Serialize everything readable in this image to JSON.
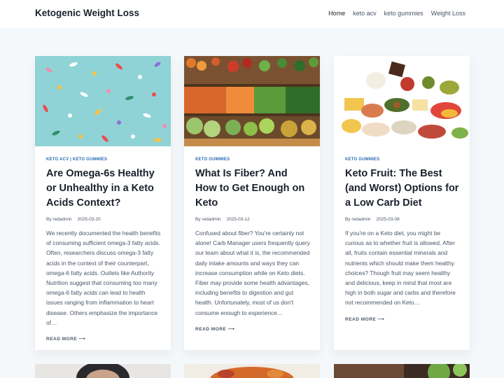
{
  "site": {
    "title": "Ketogenic Weight Loss"
  },
  "nav": [
    {
      "label": "Home"
    },
    {
      "label": "keto acv"
    },
    {
      "label": "keto gummies"
    },
    {
      "label": "Weight Loss"
    }
  ],
  "posts": [
    {
      "categories": [
        "KETO ACV",
        "KETO GUMMIES"
      ],
      "category_separator": "|",
      "title": "Are Omega-6s Healthy or Unhealthy in a Keto Acids Context?",
      "author_prefix": "By",
      "author": "redadmin",
      "date": "2025-03-20",
      "excerpt": "We recently documented the health benefits of consuming sufficient omega-3 fatty acids. Often, researchers discuss omega-3 fatty acids in the context of their counterpart, omega-6 fatty acids. Outlets like Authority Nutrition suggest that consuming too many omega-6 fatty acids can lead to health issues ranging from inflammation to heart disease. Others emphasize the importance of…",
      "read_more": "READ MORE"
    },
    {
      "categories": [
        "KETO GUMMIES"
      ],
      "title": "What Is Fiber? And How to Get Enough on Keto",
      "author_prefix": "By",
      "author": "redadmin",
      "date": "2025-03-12",
      "excerpt": "Confused about fiber? You're certainly not alone! Carb Manager users frequently query our team about what it is, the recommended daily intake amounts and ways they can increase consumption while on Keto diets. Fiber may provide some health advantages, including benefits to digestion and gut health. Unfortunately, most of us don't consume enough to experience…",
      "read_more": "READ MORE"
    },
    {
      "categories": [
        "KETO GUMMIES"
      ],
      "title": "Keto Fruit: The Best (and Worst) Options for a Low Carb Diet",
      "author_prefix": "By",
      "author": "redadmin",
      "date": "2025-03-08",
      "excerpt": "If you're on a Keto diet, you might be curious as to whether fruit is allowed. After all, fruits contain essential minerals and nutrients which should make them healthy choices? Though fruit may seem healthy and delicious, keep in mind that most are high in both sugar and carbs and therefore not recommended on Keto…",
      "read_more": "READ MORE"
    }
  ],
  "icons": {
    "arrow": "arrow-right-icon",
    "date": "calendar-icon"
  },
  "colors": {
    "accent": "#2b6cb0",
    "background": "#f5f8fb",
    "heading": "#1a202c"
  }
}
